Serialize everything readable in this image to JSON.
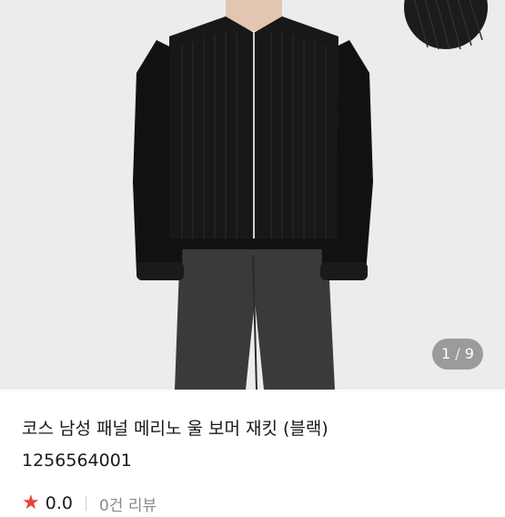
{
  "product": {
    "title": "코스 남성 패널 메리노 울 보머 재킷 (블랙)",
    "code": "1256564001",
    "rating": "0.0",
    "review_count": "0건 리뷰"
  },
  "gallery": {
    "current": "1",
    "separator": "/",
    "total": "9"
  },
  "colors": {
    "star": "#e8443a",
    "jacket": "#141414",
    "jeans": "#3a3a3a"
  }
}
